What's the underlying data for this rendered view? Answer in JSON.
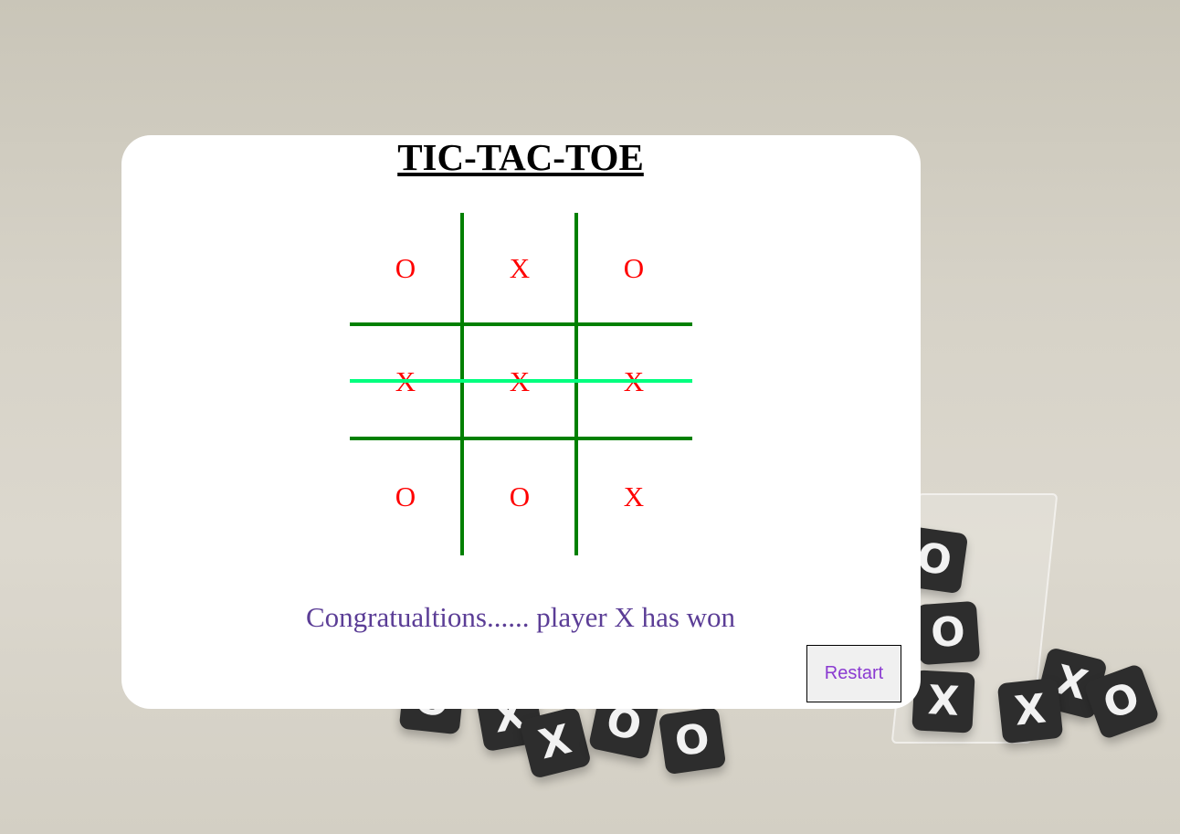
{
  "app": {
    "title": "TIC-TAC-TOE"
  },
  "board": {
    "cells": [
      "O",
      "X",
      "O",
      "X",
      "X",
      "X",
      "O",
      "O",
      "X"
    ],
    "winning_row": 2
  },
  "status": {
    "message": "Congratualtions...... player X has won"
  },
  "controls": {
    "restart_label": "Restart"
  },
  "colors": {
    "mark": "#ff0000",
    "grid": "#008000",
    "win_line": "#00ff7f",
    "message": "#5b3d96",
    "restart_text": "#8a3ad1"
  },
  "background": {
    "dice_icons": [
      "x-die-icon",
      "o-die-icon"
    ]
  }
}
